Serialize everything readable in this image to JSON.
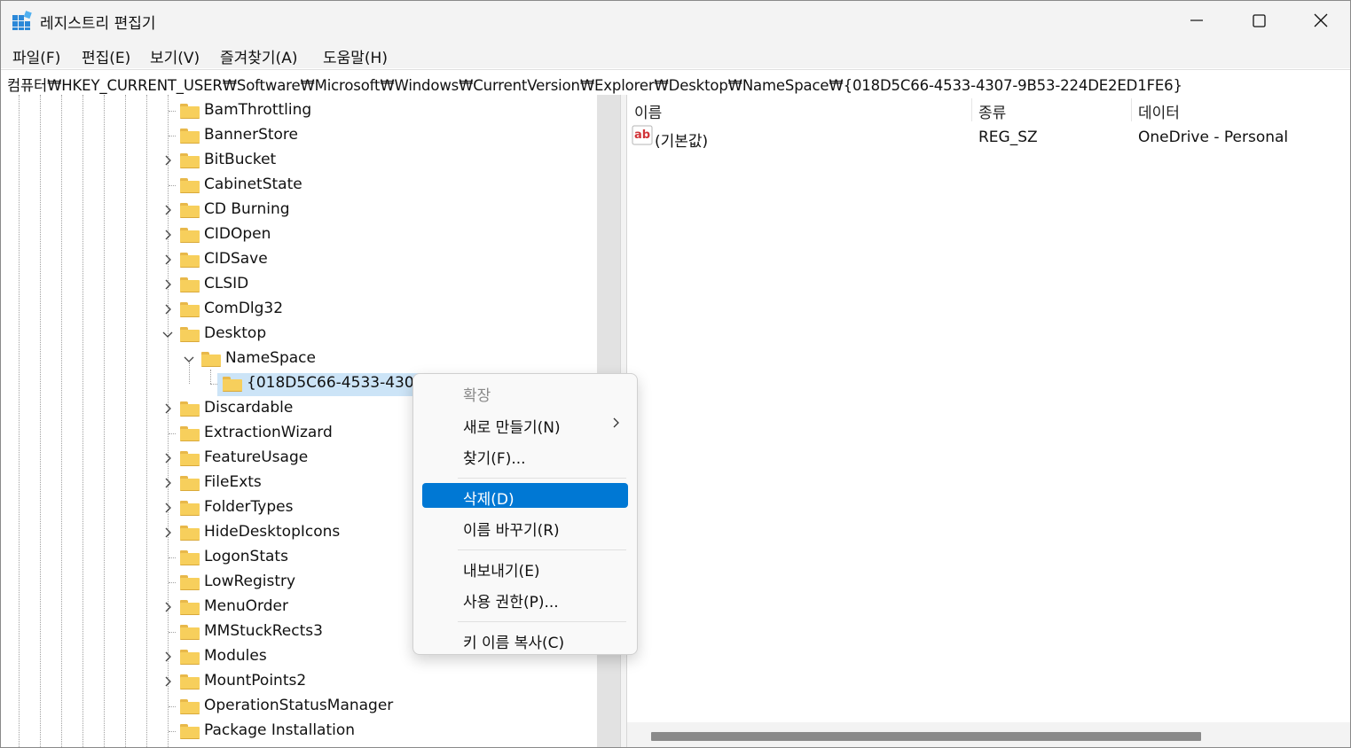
{
  "window": {
    "title": "레지스트리 편집기"
  },
  "colors": {
    "accent": "#0078d4",
    "selection": "#cce4f7",
    "folder": "#f7cf5c"
  },
  "menubar": [
    {
      "label": "파일(F)"
    },
    {
      "label": "편집(E)"
    },
    {
      "label": "보기(V)"
    },
    {
      "label": "즐겨찾기(A)"
    },
    {
      "label": "도움말(H)"
    }
  ],
  "address": {
    "value": "컴퓨터₩HKEY_CURRENT_USER₩Software₩Microsoft₩Windows₩CurrentVersion₩Explorer₩Desktop₩NameSpace₩{018D5C66-4533-4307-9B53-224DE2ED1FE6}"
  },
  "tree": {
    "items": [
      {
        "label": "BamThrottling",
        "expander": "none"
      },
      {
        "label": "BannerStore",
        "expander": "none"
      },
      {
        "label": "BitBucket",
        "expander": "collapsed"
      },
      {
        "label": "CabinetState",
        "expander": "none"
      },
      {
        "label": "CD Burning",
        "expander": "collapsed"
      },
      {
        "label": "CIDOpen",
        "expander": "collapsed"
      },
      {
        "label": "CIDSave",
        "expander": "collapsed"
      },
      {
        "label": "CLSID",
        "expander": "collapsed"
      },
      {
        "label": "ComDlg32",
        "expander": "collapsed"
      },
      {
        "label": "Desktop",
        "expander": "expanded"
      },
      {
        "label": "NameSpace",
        "expander": "expanded"
      },
      {
        "label": "{018D5C66-4533-4307-",
        "expander": "none",
        "selected": true
      },
      {
        "label": "Discardable",
        "expander": "collapsed"
      },
      {
        "label": "ExtractionWizard",
        "expander": "none"
      },
      {
        "label": "FeatureUsage",
        "expander": "collapsed"
      },
      {
        "label": "FileExts",
        "expander": "collapsed"
      },
      {
        "label": "FolderTypes",
        "expander": "collapsed"
      },
      {
        "label": "HideDesktopIcons",
        "expander": "collapsed"
      },
      {
        "label": "LogonStats",
        "expander": "none"
      },
      {
        "label": "LowRegistry",
        "expander": "none"
      },
      {
        "label": "MenuOrder",
        "expander": "collapsed"
      },
      {
        "label": "MMStuckRects3",
        "expander": "none"
      },
      {
        "label": "Modules",
        "expander": "collapsed"
      },
      {
        "label": "MountPoints2",
        "expander": "collapsed"
      },
      {
        "label": "OperationStatusManager",
        "expander": "none"
      },
      {
        "label": "Package Installation",
        "expander": "none"
      }
    ]
  },
  "list": {
    "headers": {
      "name": "이름",
      "type": "종류",
      "data": "데이터"
    },
    "rows": [
      {
        "name": "(기본값)",
        "type": "REG_SZ",
        "data": "OneDrive - Personal",
        "icon": "string-value-icon"
      }
    ]
  },
  "context_menu": {
    "items": [
      {
        "label": "확장",
        "state": "disabled"
      },
      {
        "label": "새로 만들기(N)",
        "state": "normal",
        "submenu": true
      },
      {
        "label": "찾기(F)...",
        "state": "normal"
      },
      {
        "separator": true
      },
      {
        "label": "삭제(D)",
        "state": "highlighted"
      },
      {
        "label": "이름 바꾸기(R)",
        "state": "normal"
      },
      {
        "separator": true
      },
      {
        "label": "내보내기(E)",
        "state": "normal"
      },
      {
        "label": "사용 권한(P)...",
        "state": "normal"
      },
      {
        "separator": true
      },
      {
        "label": "키 이름 복사(C)",
        "state": "normal"
      }
    ]
  }
}
